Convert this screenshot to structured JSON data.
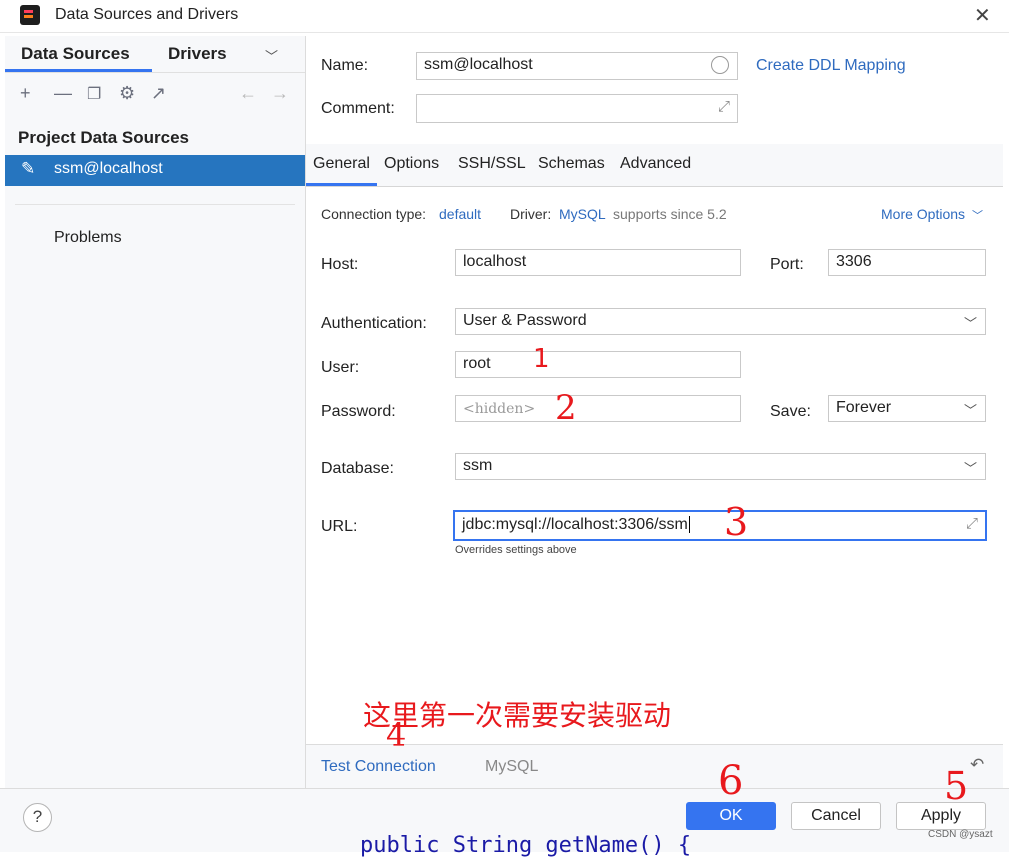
{
  "window": {
    "title": "Data Sources and Drivers"
  },
  "left_panel": {
    "tabs": [
      "Data Sources",
      "Drivers"
    ],
    "section_header": "Project Data Sources",
    "selected_item": "ssm@localhost",
    "problems_label": "Problems"
  },
  "form": {
    "name_label": "Name:",
    "name_value": "ssm@localhost",
    "ddl_link": "Create DDL Mapping",
    "comment_label": "Comment:",
    "comment_value": ""
  },
  "tabs": [
    "General",
    "Options",
    "SSH/SSL",
    "Schemas",
    "Advanced"
  ],
  "general": {
    "connection_type_label": "Connection type:",
    "connection_type_value": "default",
    "driver_label": "Driver:",
    "driver_value": "MySQL",
    "driver_note": "supports since 5.2",
    "more_options": "More Options",
    "host_label": "Host:",
    "host_value": "localhost",
    "port_label": "Port:",
    "port_value": "3306",
    "auth_label": "Authentication:",
    "auth_value": "User & Password",
    "user_label": "User:",
    "user_value": "root",
    "password_label": "Password:",
    "password_placeholder": "<hidden>",
    "save_label": "Save:",
    "save_value": "Forever",
    "database_label": "Database:",
    "database_value": "ssm",
    "url_label": "URL:",
    "url_value": "jdbc:mysql://localhost:3306/ssm",
    "url_note": "Overrides settings above"
  },
  "bottom": {
    "test_connection": "Test Connection",
    "driver_name": "MySQL"
  },
  "footer": {
    "help": "?",
    "ok": "OK",
    "cancel": "Cancel",
    "apply": "Apply"
  },
  "annotations": {
    "note_zh": "这里第一次需要安装驱动",
    "n1": "1",
    "n2": "2",
    "n3": "3",
    "n4": "4",
    "n5": "5",
    "n6": "6"
  },
  "watermark": "CSDN @ysazt",
  "background_code": "public String getName() {"
}
